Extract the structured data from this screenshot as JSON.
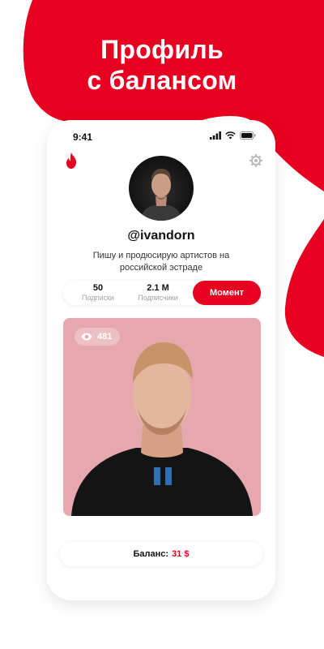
{
  "headline": {
    "line1": "Профиль",
    "line2": "с балансом"
  },
  "status_bar": {
    "time": "9:41",
    "icons": [
      "signal-icon",
      "wifi-icon",
      "battery-icon"
    ]
  },
  "header": {
    "logo_icon": "flame-icon",
    "settings_icon": "gear-icon"
  },
  "profile": {
    "username": "@ivandorn",
    "bio": "Пишу и продюсирую артистов на российской эстраде",
    "stats": [
      {
        "value": "50",
        "label": "Подписки"
      },
      {
        "value": "2.1 M",
        "label": "Подписчики"
      }
    ],
    "action_button": "Момент"
  },
  "post": {
    "views_icon": "eye-icon",
    "views": "481"
  },
  "balance": {
    "label": "Баланс:",
    "amount": "31 $"
  },
  "colors": {
    "accent": "#e7001f",
    "photo_bg": "#e6a8ae"
  }
}
